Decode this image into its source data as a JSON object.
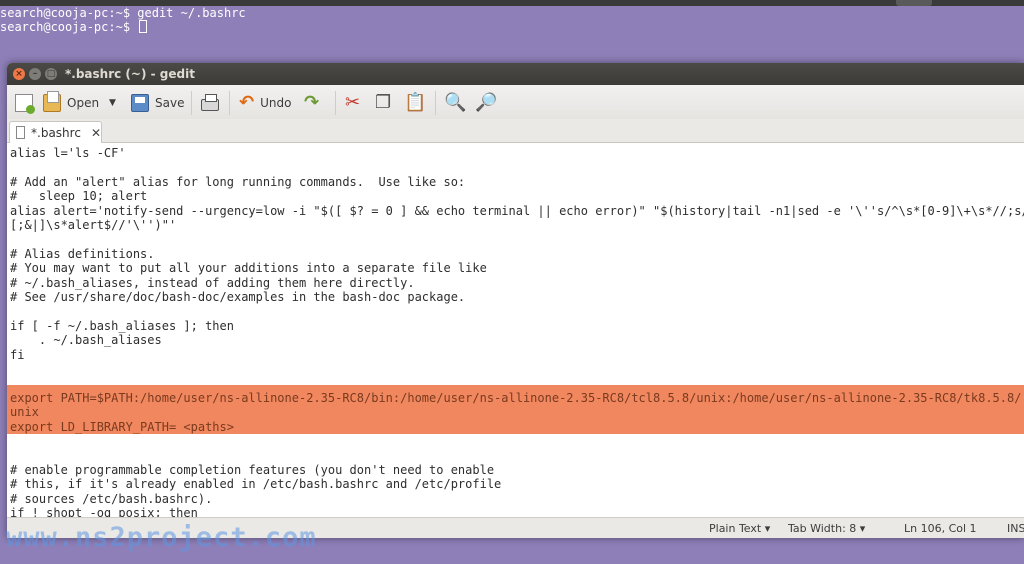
{
  "terminal": {
    "lines": [
      "search@cooja-pc:~$ gedit ~/.bashrc",
      "search@cooja-pc:~$ "
    ]
  },
  "window": {
    "title": "*.bashrc (~) - gedit"
  },
  "toolbar": {
    "open_label": "Open",
    "save_label": "Save",
    "undo_label": "Undo",
    "icons": [
      "new-document-icon",
      "open-icon",
      "dropdown-arrow-icon",
      "save-icon",
      "print-icon",
      "undo-icon",
      "redo-icon",
      "cut-icon",
      "copy-icon",
      "paste-icon",
      "find-icon",
      "find-replace-icon"
    ]
  },
  "tab": {
    "label": "*.bashrc"
  },
  "editor": {
    "highlight_color": "#f0875f",
    "lines": [
      "alias l='ls -CF'",
      "",
      "# Add an \"alert\" alias for long running commands.  Use like so:",
      "#   sleep 10; alert",
      "alias alert='notify-send --urgency=low -i \"$([ $? = 0 ] && echo terminal || echo error)\" \"$(history|tail -n1|sed -e '\\''s/^\\s*[0-9]\\+\\s*//;s/",
      "[;&|]\\s*alert$//'\\'')\"'",
      "",
      "# Alias definitions.",
      "# You may want to put all your additions into a separate file like",
      "# ~/.bash_aliases, instead of adding them here directly.",
      "# See /usr/share/doc/bash-doc/examples in the bash-doc package.",
      "",
      "if [ -f ~/.bash_aliases ]; then",
      "    . ~/.bash_aliases",
      "fi",
      "",
      "",
      "export PATH=$PATH:/home/user/ns-allinone-2.35-RC8/bin:/home/user/ns-allinone-2.35-RC8/tcl8.5.8/unix:/home/user/ns-allinone-2.35-RC8/tk8.5.8/",
      "unix",
      "export LD_LIBRARY_PATH= <paths>",
      "",
      "",
      "# enable programmable completion features (you don't need to enable",
      "# this, if it's already enabled in /etc/bash.bashrc and /etc/profile",
      "# sources /etc/bash.bashrc).",
      "if ! shopt -oq posix; then"
    ]
  },
  "statusbar": {
    "language": "Plain Text ▾",
    "tab_width": "Tab Width: 8 ▾",
    "position": "Ln 106, Col 1",
    "mode": "INS"
  },
  "watermark": "www.ns2project.com"
}
